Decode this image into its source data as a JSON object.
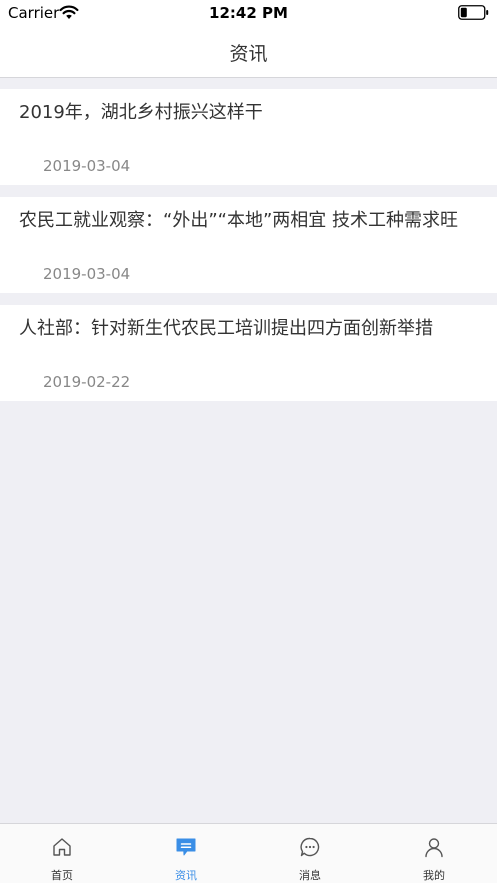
{
  "status_bar": {
    "carrier": "Carrier",
    "time": "12:42 PM"
  },
  "nav": {
    "title": "资讯"
  },
  "news": [
    {
      "title": "2019年，湖北乡村振兴这样干",
      "date": "2019-03-04"
    },
    {
      "title": "农民工就业观察：“外出”“本地”两相宜 技术工种需求旺",
      "date": "2019-03-04"
    },
    {
      "title": "人社部：针对新生代农民工培训提出四方面创新举措",
      "date": "2019-02-22"
    }
  ],
  "tab_bar": {
    "tabs": [
      {
        "label": "首页",
        "icon": "home-icon",
        "active": false
      },
      {
        "label": "资讯",
        "icon": "news-icon",
        "active": true
      },
      {
        "label": "消息",
        "icon": "message-icon",
        "active": false
      },
      {
        "label": "我的",
        "icon": "profile-icon",
        "active": false
      }
    ]
  },
  "colors": {
    "accent": "#3a8ee6",
    "background": "#efeff4",
    "text": "#333333",
    "date_text": "#888888"
  }
}
